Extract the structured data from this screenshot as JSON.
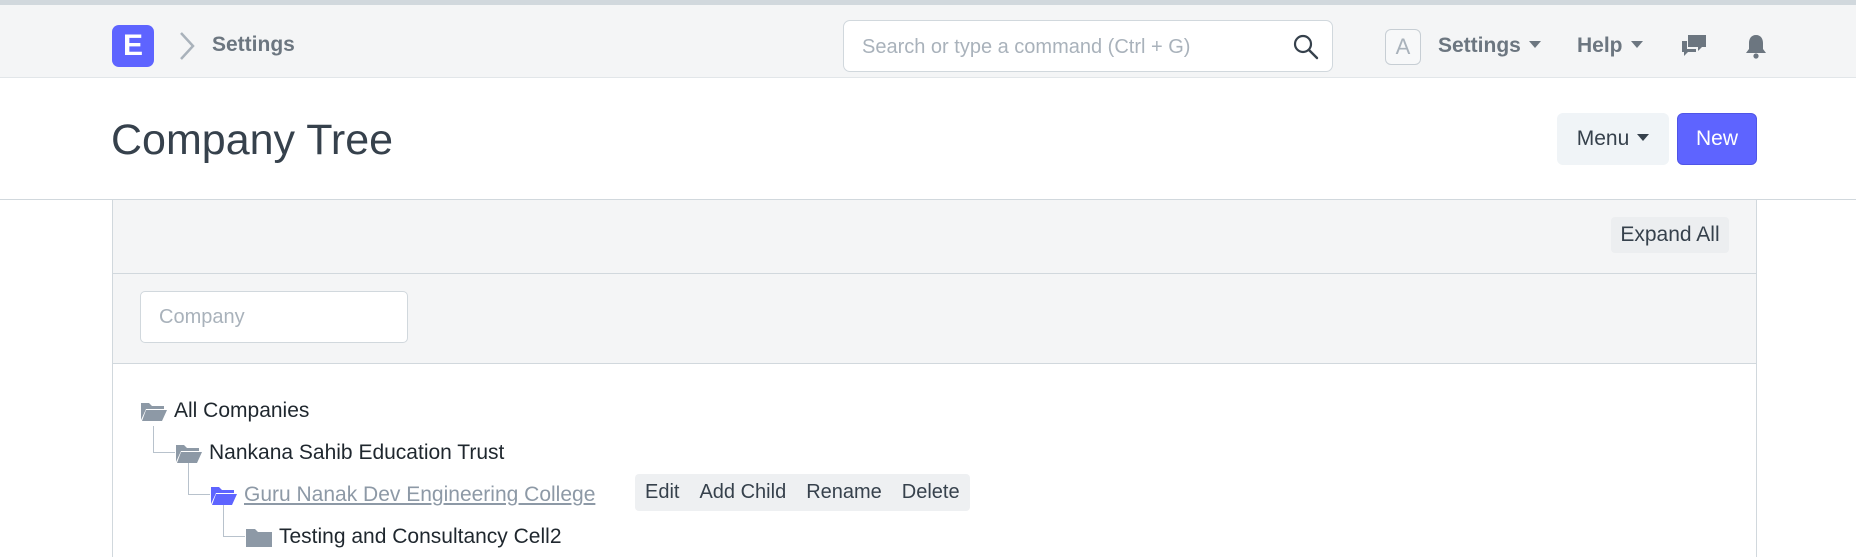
{
  "navbar": {
    "logo_letter": "E",
    "breadcrumb": "Settings",
    "search_placeholder": "Search or type a command (Ctrl + G)",
    "avatar_letter": "A",
    "settings_label": "Settings",
    "help_label": "Help"
  },
  "page": {
    "title": "Company Tree",
    "menu_label": "Menu",
    "new_label": "New"
  },
  "tree": {
    "expand_all_label": "Expand All",
    "filter_placeholder": "Company",
    "nodes": [
      {
        "label": "All Companies"
      },
      {
        "label": "Nankana Sahib Education Trust"
      },
      {
        "label": "Guru Nanak Dev Engineering College"
      },
      {
        "label": "Testing and Consultancy Cell2"
      }
    ],
    "toolbar": [
      "Edit",
      "Add Child",
      "Rename",
      "Delete"
    ]
  },
  "colors": {
    "accent": "#5e64ff",
    "folder": "#8d99a6",
    "navbar_bg": "#f4f5f6",
    "text_muted": "#6c7680"
  },
  "icons": [
    "chevron-right-icon",
    "search-icon",
    "chat-icon",
    "bell-icon",
    "folder-open-icon",
    "folder-icon"
  ]
}
